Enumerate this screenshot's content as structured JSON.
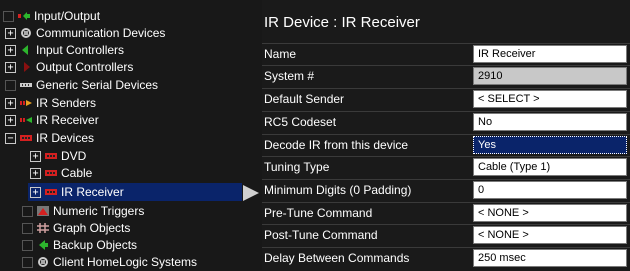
{
  "tree": {
    "items": [
      {
        "label": "Input/Output",
        "expander": "blank",
        "icon": "input-output-icon"
      },
      {
        "label": "Communication Devices",
        "expander": "+",
        "icon": "communication-devices-icon"
      },
      {
        "label": "Input Controllers",
        "expander": "+",
        "icon": "input-controllers-icon"
      },
      {
        "label": "Output Controllers",
        "expander": "+",
        "icon": "output-controllers-icon"
      },
      {
        "label": "Generic Serial Devices",
        "expander": "blank",
        "icon": "serial-device-icon"
      },
      {
        "label": "IR Senders",
        "expander": "+",
        "icon": "ir-senders-icon"
      },
      {
        "label": "IR Receiver",
        "expander": "+",
        "icon": "ir-receiver-icon"
      },
      {
        "label": "IR Devices",
        "expander": "−",
        "icon": "ir-devices-icon"
      },
      {
        "label": "DVD",
        "expander": "+",
        "icon": "ir-device-icon"
      },
      {
        "label": "Cable",
        "expander": "+",
        "icon": "ir-device-icon"
      },
      {
        "label": "IR Receiver",
        "expander": "+",
        "icon": "ir-device-icon"
      },
      {
        "label": "Numeric Triggers",
        "expander": "blank",
        "icon": "numeric-triggers-icon"
      },
      {
        "label": "Graph Objects",
        "expander": "blank",
        "icon": "graph-objects-icon"
      },
      {
        "label": "Backup Objects",
        "expander": "blank",
        "icon": "backup-objects-icon"
      },
      {
        "label": "Client HomeLogic Systems",
        "expander": "blank",
        "icon": "client-systems-icon"
      }
    ]
  },
  "panel": {
    "title": "IR Device : IR Receiver",
    "properties": [
      {
        "label": "Name",
        "value": "IR Receiver"
      },
      {
        "label": "System #",
        "value": "2910"
      },
      {
        "label": "Default Sender",
        "value": "< SELECT >"
      },
      {
        "label": "RC5 Codeset",
        "value": "No"
      },
      {
        "label": "Decode IR from this device",
        "value": "Yes"
      },
      {
        "label": "Tuning Type",
        "value": "Cable (Type 1)"
      },
      {
        "label": "Minimum Digits (0 Padding)",
        "value": "0"
      },
      {
        "label": "Pre-Tune Command",
        "value": "< NONE >"
      },
      {
        "label": "Post-Tune Command",
        "value": "< NONE >"
      },
      {
        "label": "Delay Between Commands",
        "value": "250 msec"
      }
    ]
  },
  "colors": {
    "background": "#1a1a1a",
    "selection": "#0a246a",
    "accent_green": "#2db52d",
    "accent_red": "#d42020"
  }
}
